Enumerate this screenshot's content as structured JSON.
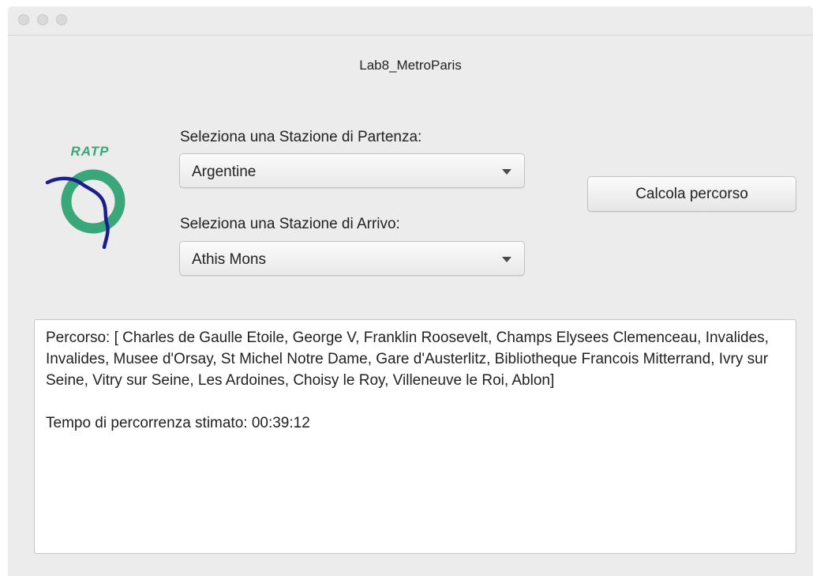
{
  "window": {
    "title": "Lab8_MetroParis"
  },
  "logo": {
    "text": "RATP",
    "colors": {
      "ring": "#3aa77a",
      "line": "#1b1f8c"
    }
  },
  "form": {
    "departure_label": "Seleziona una Stazione di Partenza:",
    "departure_value": "Argentine",
    "arrival_label": "Seleziona una Stazione di Arrivo:",
    "arrival_value": "Athis Mons",
    "calculate_button": "Calcola percorso"
  },
  "result": {
    "route": "Percorso: [ Charles de Gaulle Etoile, George V, Franklin Roosevelt, Champs Elysees Clemenceau, Invalides, Invalides, Musee d'Orsay, St Michel Notre Dame, Gare d'Austerlitz, Bibliotheque Francois Mitterrand, Ivry sur Seine, Vitry sur Seine, Les Ardoines, Choisy le Roy, Villeneuve le Roi, Ablon]",
    "time": "Tempo di percorrenza stimato: 00:39:12"
  },
  "icons": {
    "window_controls": [
      "close-icon",
      "minimize-icon",
      "zoom-icon"
    ],
    "dropdown": "chevron-down-icon"
  }
}
